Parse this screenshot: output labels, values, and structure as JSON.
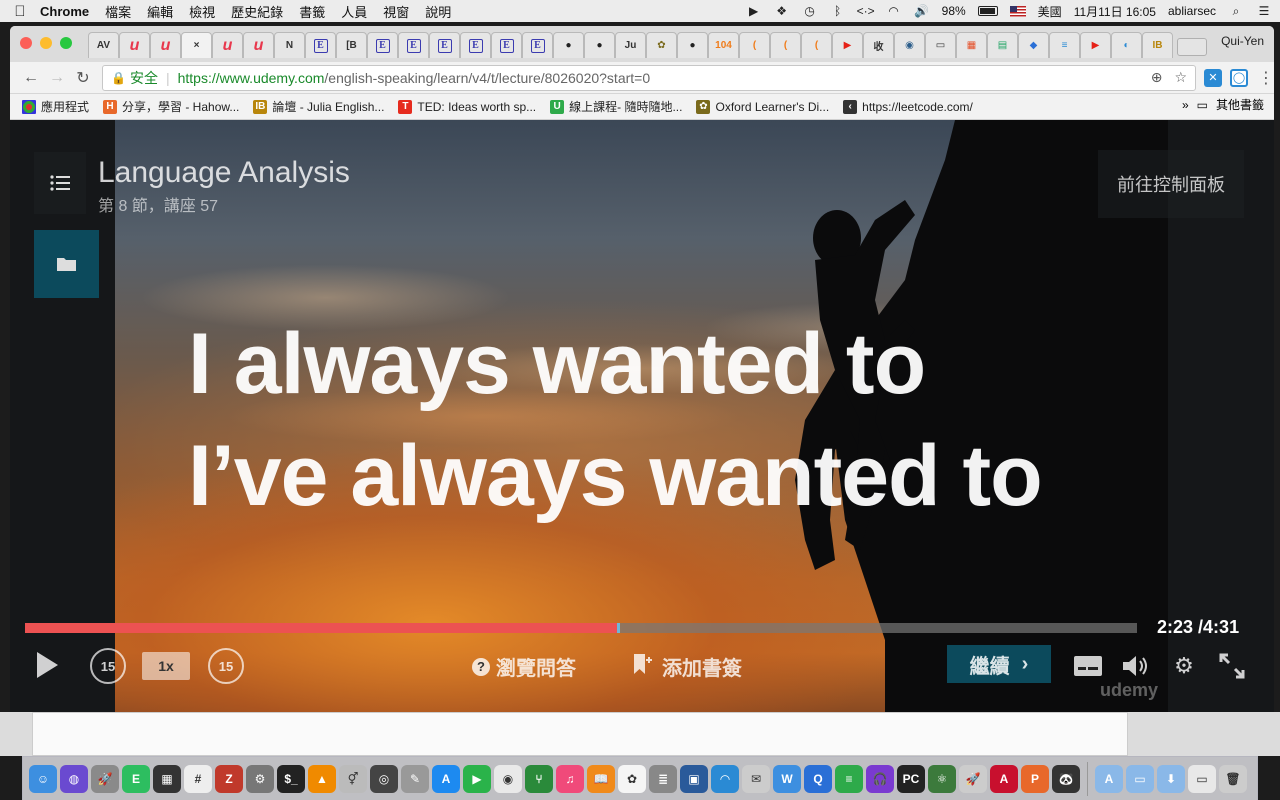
{
  "menubar": {
    "app_name": "Chrome",
    "items": [
      "檔案",
      "編輯",
      "檢視",
      "歷史紀錄",
      "書籤",
      "人員",
      "視窗",
      "說明"
    ],
    "battery": "98%",
    "input_source": "美國",
    "datetime": "11月11日  16:05",
    "user": "abliarsec"
  },
  "browser": {
    "profile_name": "Qui-Yen",
    "tabs": [
      {
        "label": "AV",
        "icon": "text"
      },
      {
        "label": "u",
        "icon": "udemy",
        "color": "#e8374c"
      },
      {
        "label": "u",
        "icon": "udemy",
        "color": "#e8374c"
      },
      {
        "label": "×",
        "icon": "close",
        "active": true
      },
      {
        "label": "u",
        "icon": "udemy",
        "color": "#e8374c"
      },
      {
        "label": "u",
        "icon": "udemy",
        "color": "#e8374c"
      },
      {
        "label": "N",
        "icon": "doc"
      },
      {
        "label": "E",
        "icon": "e-box",
        "color": "#3b3bb0"
      },
      {
        "label": "[B",
        "icon": "text"
      },
      {
        "label": "E",
        "icon": "e-box",
        "color": "#3b3bb0"
      },
      {
        "label": "E",
        "icon": "e-box",
        "color": "#3b3bb0"
      },
      {
        "label": "E",
        "icon": "e-box",
        "color": "#3b3bb0"
      },
      {
        "label": "E",
        "icon": "e-box",
        "color": "#3b3bb0"
      },
      {
        "label": "E",
        "icon": "e-box",
        "color": "#3b3bb0"
      },
      {
        "label": "E",
        "icon": "e-box",
        "color": "#3b3bb0"
      },
      {
        "label": "●",
        "icon": "github",
        "color": "#222"
      },
      {
        "label": "●",
        "icon": "github",
        "color": "#222"
      },
      {
        "label": "Ju",
        "icon": "text"
      },
      {
        "label": "✿",
        "icon": "oxford",
        "color": "#7a6a1c"
      },
      {
        "label": "●",
        "icon": "github",
        "color": "#222"
      },
      {
        "label": "104",
        "icon": "orange-circle",
        "color": "#f07c1a"
      },
      {
        "label": "(",
        "icon": "orange-ring",
        "color": "#f07c1a"
      },
      {
        "label": "(",
        "icon": "orange-ring",
        "color": "#f07c1a"
      },
      {
        "label": "(",
        "icon": "orange-ring",
        "color": "#f07c1a"
      },
      {
        "label": "▶",
        "icon": "youtube",
        "color": "#e62117"
      },
      {
        "label": "收",
        "icon": "text"
      },
      {
        "label": "◉",
        "icon": "blue-circle",
        "color": "#2b5d8a"
      },
      {
        "label": "▭",
        "icon": "page"
      },
      {
        "label": "▦",
        "icon": "windows",
        "color": "#e44d26"
      },
      {
        "label": "▤",
        "icon": "green-doc",
        "color": "#1fa463"
      },
      {
        "label": "◆",
        "icon": "blue-diamond",
        "color": "#2a6fd6"
      },
      {
        "label": "≡",
        "icon": "filter",
        "color": "#2a8ad4"
      },
      {
        "label": "▶",
        "icon": "youtube",
        "color": "#e62117"
      },
      {
        "label": "◐",
        "icon": "edge",
        "color": "#2a8ad4"
      },
      {
        "label": "IB",
        "icon": "gold-circle",
        "color": "#b8860b"
      }
    ],
    "back_icon": "back-arrow-icon",
    "forward_icon": "forward-arrow-icon",
    "reload_icon": "reload-icon",
    "secure_label": "安全",
    "url_prefix": "https://",
    "url_host": "www.udemy.com",
    "url_path": "/english-speaking/learn/v4/t/lecture/8026020?start=0",
    "bookmarks": [
      {
        "label": "應用程式",
        "icon": "apps-grid-icon",
        "color": "#d33"
      },
      {
        "label": "分享，學習 - Hahow...",
        "icon": "H",
        "color": "#e8682a"
      },
      {
        "label": "論壇 - Julia English...",
        "icon": "IB",
        "color": "#b8860b"
      },
      {
        "label": "TED: Ideas worth sp...",
        "icon": "T",
        "color": "#e62b1e"
      },
      {
        "label": "線上課程- 隨時隨地...",
        "icon": "U",
        "color": "#2eaa4a"
      },
      {
        "label": "Oxford Learner's Di...",
        "icon": "✿",
        "color": "#7a6a1c"
      },
      {
        "label": "https://leetcode.com/",
        "icon": "‹",
        "color": "#333"
      }
    ],
    "bookmarks_more": "»",
    "other_bookmarks": "其他書籤"
  },
  "player": {
    "course_title": "Language Analysis",
    "lecture_info": "第 8 節，講座 57",
    "dashboard_label": "前往控制面板",
    "caption_line1": "I always wanted to",
    "caption_line2": "I’ve always wanted to",
    "progress": 0.532,
    "current_time": "2:23",
    "duration": "/4:31",
    "skip_back": "15",
    "skip_forward": "15",
    "speed": "1x",
    "qa_label": "瀏覽問答",
    "bookmark_label": "添加書簽",
    "continue_label": "繼續",
    "watermark": "udemy",
    "accent_color": "#ec5252",
    "panel_color": "#0c4a5c"
  },
  "dock": {
    "apps": [
      {
        "name": "finder",
        "color": "#3d8fe0",
        "glyph": "☺"
      },
      {
        "name": "siri",
        "color": "#6a4ad0",
        "glyph": "◍"
      },
      {
        "name": "launchpad",
        "color": "#8a8a8a",
        "glyph": "🚀"
      },
      {
        "name": "evernote",
        "color": "#2dbe60",
        "glyph": "E"
      },
      {
        "name": "mission-control",
        "color": "#333",
        "glyph": "▦"
      },
      {
        "name": "notes-hash",
        "color": "#eee",
        "glyph": "#"
      },
      {
        "name": "filezilla",
        "color": "#c0392b",
        "glyph": "Z"
      },
      {
        "name": "system-prefs",
        "color": "#777",
        "glyph": "⚙"
      },
      {
        "name": "terminal",
        "color": "#222",
        "glyph": "$_"
      },
      {
        "name": "vlc",
        "color": "#f08a00",
        "glyph": "▲"
      },
      {
        "name": "gender-app",
        "color": "#bbb",
        "glyph": "⚥"
      },
      {
        "name": "quicktime",
        "color": "#444",
        "glyph": "◎"
      },
      {
        "name": "preview",
        "color": "#999",
        "glyph": "✎"
      },
      {
        "name": "app-store",
        "color": "#1d8af0",
        "glyph": "A"
      },
      {
        "name": "facetime",
        "color": "#2ab34a",
        "glyph": "▶"
      },
      {
        "name": "chrome",
        "color": "#e9e9e9",
        "glyph": "◉"
      },
      {
        "name": "sourcetree",
        "color": "#2a8a3a",
        "glyph": "⑂"
      },
      {
        "name": "itunes",
        "color": "#f04a7a",
        "glyph": "♫"
      },
      {
        "name": "ibooks",
        "color": "#f08a1a",
        "glyph": "📖"
      },
      {
        "name": "photos",
        "color": "#f5f5f5",
        "glyph": "✿"
      },
      {
        "name": "sequel",
        "color": "#888",
        "glyph": "≣"
      },
      {
        "name": "virtualbox",
        "color": "#2a5a9a",
        "glyph": "▣"
      },
      {
        "name": "wifi-app",
        "color": "#2a8ad4",
        "glyph": "◠"
      },
      {
        "name": "preview-2",
        "color": "#ccc",
        "glyph": "✉"
      },
      {
        "name": "wunderlist",
        "color": "#3d8fe0",
        "glyph": "W"
      },
      {
        "name": "quip",
        "color": "#2a6fd6",
        "glyph": "Q"
      },
      {
        "name": "istat",
        "color": "#2eaa4a",
        "glyph": "≡"
      },
      {
        "name": "headphones",
        "color": "#7a3ad0",
        "glyph": "🎧"
      },
      {
        "name": "pycharm",
        "color": "#222",
        "glyph": "PC"
      },
      {
        "name": "atom",
        "color": "#3c7a3c",
        "glyph": "⚛"
      },
      {
        "name": "rocket",
        "color": "#ccc",
        "glyph": "🚀"
      },
      {
        "name": "acrobat",
        "color": "#c8102e",
        "glyph": "A"
      },
      {
        "name": "powerpoint",
        "color": "#e8682a",
        "glyph": "P"
      },
      {
        "name": "panda",
        "color": "#333",
        "glyph": "🐼"
      }
    ],
    "stack_items": [
      {
        "name": "apps-folder",
        "color": "#8ab8e8",
        "glyph": "A"
      },
      {
        "name": "docs-folder",
        "color": "#8ab8e8",
        "glyph": "▭"
      },
      {
        "name": "downloads-folder",
        "color": "#8ab8e8",
        "glyph": "⬇"
      },
      {
        "name": "misc-folder",
        "color": "#e8e8e8",
        "glyph": "▭"
      },
      {
        "name": "trash",
        "color": "#ccc",
        "glyph": "🗑"
      }
    ]
  }
}
